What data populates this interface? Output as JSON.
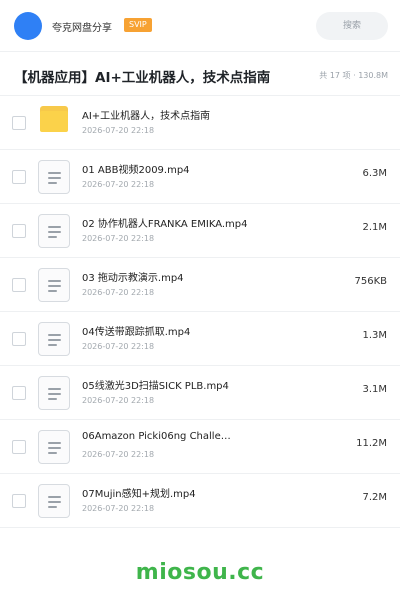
{
  "header": {
    "brand": "夸克网盘分享",
    "vip_badge": "SVIP",
    "search_label": "搜索"
  },
  "folder": {
    "title": "【机器应用】AI+工业机器人，技术点指南",
    "meta": "共 17 项 · 130.8M"
  },
  "items": [
    {
      "type": "folder",
      "name": "AI+工业机器人，技术点指南",
      "date": "2026-07-20 22:18",
      "size": ""
    },
    {
      "type": "file",
      "name": "01 ABB视频2009.mp4",
      "date": "2026-07-20 22:18",
      "size": "6.3M"
    },
    {
      "type": "file",
      "name": "02 协作机器人FRANKA EMIKA.mp4",
      "date": "2026-07-20 22:18",
      "size": "2.1M"
    },
    {
      "type": "file",
      "name": "03 拖动示教演示.mp4",
      "date": "2026-07-20 22:18",
      "size": "756KB"
    },
    {
      "type": "file",
      "name": "04传送带跟踪抓取.mp4",
      "date": "2026-07-20 22:18",
      "size": "1.3M"
    },
    {
      "type": "file",
      "name": "05线激光3D扫描SICK PLB.mp4",
      "date": "2026-07-20 22:18",
      "size": "3.1M"
    },
    {
      "type": "file",
      "name": "06Amazon Picki06ng Challe…",
      "date": "2026-07-20 22:18",
      "size": "11.2M"
    },
    {
      "type": "file",
      "name": "07Mujin感知+规划.mp4",
      "date": "2026-07-20 22:18",
      "size": "7.2M"
    }
  ],
  "watermark": "miosou.cc",
  "colors": {
    "accent": "#2f80f5",
    "vip": "#f7a233",
    "folder": "#fbd24a",
    "watermark": "#3fb54b"
  }
}
